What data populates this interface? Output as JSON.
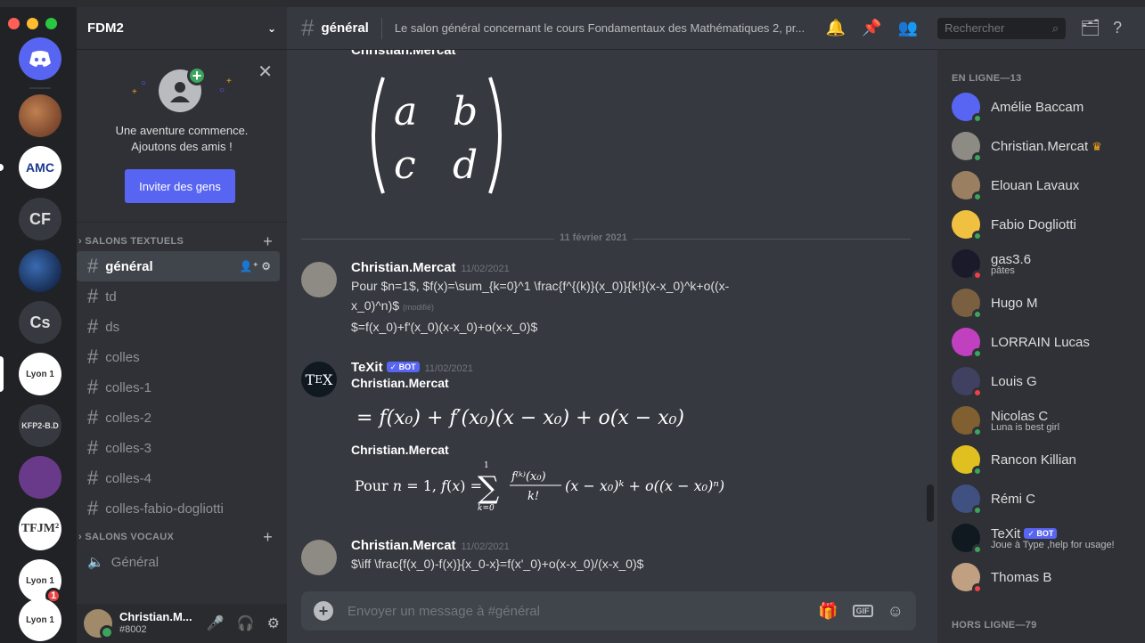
{
  "server": {
    "name": "FDM2",
    "rail": [
      {
        "label": "",
        "kind": "discord"
      },
      {
        "label": "",
        "kind": "img"
      },
      {
        "label": "AMC",
        "kind": "text"
      },
      {
        "label": "CF",
        "kind": "text"
      },
      {
        "label": "",
        "kind": "img"
      },
      {
        "label": "Cs",
        "kind": "text"
      },
      {
        "label": "Lyon 1",
        "kind": "text"
      },
      {
        "label": "KFP2-B.D",
        "kind": "text"
      },
      {
        "label": "",
        "kind": "img"
      },
      {
        "label": "TFJM²",
        "kind": "text"
      },
      {
        "label": "Lyon 1",
        "kind": "text",
        "badge": "1"
      },
      {
        "label": "Lyon 1",
        "kind": "text"
      }
    ]
  },
  "friends_card": {
    "message": "Une aventure commence. Ajoutons des amis !",
    "line1": "Une aventure commence.",
    "line2": "Ajoutons des amis !",
    "invite_label": "Inviter des gens"
  },
  "categories": {
    "text": "SALONS TEXTUELS",
    "voice": "SALONS VOCAUX"
  },
  "text_channels": [
    "général",
    "td",
    "ds",
    "colles",
    "colles-1",
    "colles-2",
    "colles-3",
    "colles-4",
    "colles-fabio-dogliotti"
  ],
  "voice_channels": [
    "Général"
  ],
  "user": {
    "name": "Christian.M...",
    "tag": "#8002"
  },
  "header": {
    "channel": "général",
    "topic": "Le salon général concernant le cours Fondamentaux des Mathématiques 2, pr...",
    "search_placeholder": "Rechercher"
  },
  "messages": {
    "top_author": "Christian.Mercat",
    "date_divider": "11 février 2021",
    "m1": {
      "author": "Christian.Mercat",
      "time": "11/02/2021",
      "line1": "Pour $n=1$, $f(x)=\\sum_{k=0}^1 \\frac{f^{(k)}(x_0)}{k!}(x-x_0)^k+o((x-",
      "line2": "x_0)^n)$",
      "edited": "(modifié)",
      "line3": "$=f(x_0)+f'(x_0)(x-x_0)+o(x-x_0)$"
    },
    "m2": {
      "author": "TeXit",
      "bot": "✓ BOT",
      "time": "11/02/2021",
      "sub1": "Christian.Mercat",
      "sub2": "Christian.Mercat"
    },
    "m3": {
      "author": "Christian.Mercat",
      "time": "11/02/2021",
      "line1": "$\\iff \\frac{f(x_0)-f(x)}{x_0-x}=f(x'_0)+o(x-x_0)/(x-x_0)$"
    }
  },
  "composer": {
    "placeholder": "Envoyer un message à #général",
    "gif": "GIF"
  },
  "members": {
    "online_header": "EN LIGNE—13",
    "offline_header": "HORS LIGNE—79",
    "list": [
      {
        "name": "Amélie Baccam",
        "status": "online",
        "color": "#5865f2"
      },
      {
        "name": "Christian.Mercat",
        "status": "online",
        "color": "#8e8a84",
        "crown": "♛"
      },
      {
        "name": "Elouan Lavaux",
        "status": "mobile",
        "color": "#9a8060"
      },
      {
        "name": "Fabio Dogliotti",
        "status": "online",
        "color": "#f0c040"
      },
      {
        "name": "gas3.6",
        "status": "dnd",
        "color": "#1a1a2a",
        "sub": "pâtes"
      },
      {
        "name": "Hugo M",
        "status": "online",
        "color": "#7a6040"
      },
      {
        "name": "LORRAIN Lucas",
        "status": "online",
        "color": "#c040c0"
      },
      {
        "name": "Louis G",
        "status": "dnd",
        "color": "#404060"
      },
      {
        "name": "Nicolas C",
        "status": "online",
        "color": "#806030",
        "sub": "Luna is best girl"
      },
      {
        "name": "Rancon Killian",
        "status": "online",
        "color": "#e0c020"
      },
      {
        "name": "Rémi C",
        "status": "online",
        "color": "#405080"
      },
      {
        "name": "TeXit",
        "status": "online",
        "color": "#101820",
        "bot": "✓ BOT",
        "sub": "Joue à Type ,help for usage!"
      },
      {
        "name": "Thomas B",
        "status": "dnd",
        "color": "#c0a080"
      }
    ]
  }
}
